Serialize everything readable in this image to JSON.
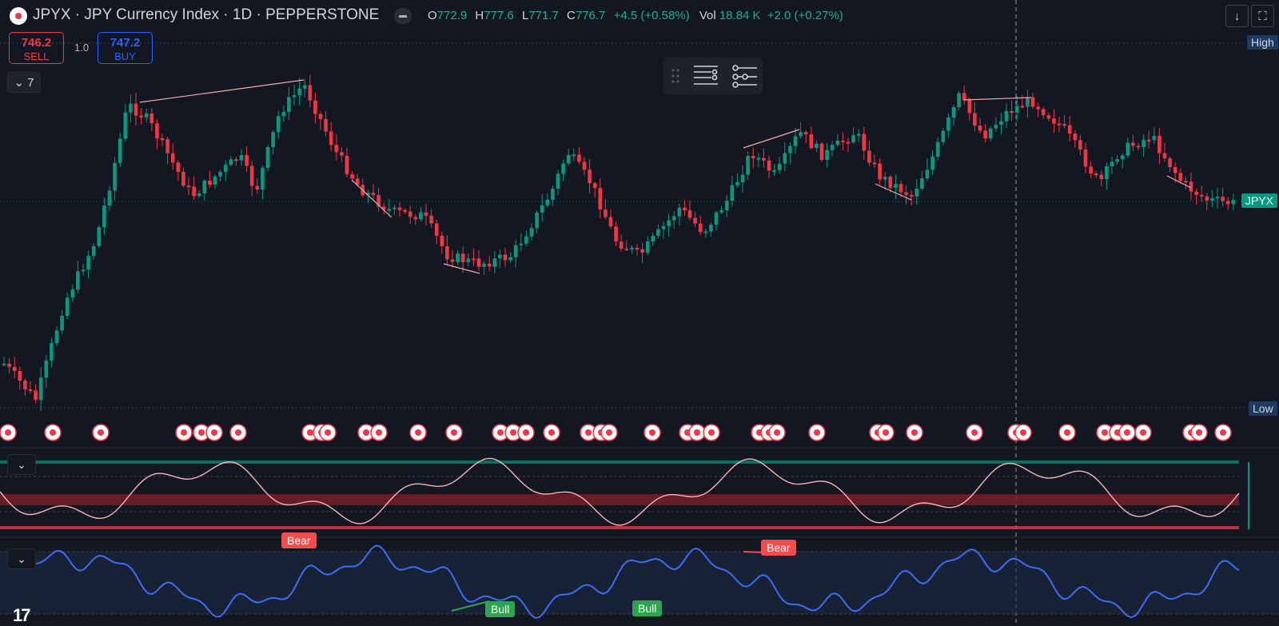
{
  "header": {
    "title": "JPYX · JPY Currency Index · 1D · PEPPERSTONE",
    "ohlc": [
      {
        "k": "O",
        "v": "772.9"
      },
      {
        "k": "H",
        "v": "777.6"
      },
      {
        "k": "L",
        "v": "771.7"
      },
      {
        "k": "C",
        "v": "776.7"
      }
    ],
    "change": "+4.5 (+0.58%)",
    "vol_label": "Vol",
    "vol_value": "18.84 K",
    "vol_change": "+2.0 (+0.27%)"
  },
  "trade": {
    "sell_price": "746.2",
    "sell_label": "SELL",
    "buy_price": "747.2",
    "buy_label": "BUY",
    "quantity": "1.0"
  },
  "indicators_collapse": {
    "count": "7"
  },
  "price_axis": {
    "high_label": "High",
    "low_label": "Low",
    "symbol_label": "JPYX"
  },
  "oscillator_labels": {
    "bear_top": "Bear",
    "bear_mid": "Bear",
    "bull_1": "Bull",
    "bull_2": "Bull"
  },
  "colors": {
    "up": "#089981",
    "down": "#f23645",
    "background": "#131722",
    "oscillator_line": "#3d6cf5"
  },
  "icons": [
    "record-icon",
    "minus-icon",
    "download-icon",
    "fullscreen-icon",
    "chevron-down-icon",
    "drag-handle-icon",
    "object-tree-icon",
    "settings-icon",
    "tradingview-logo-icon"
  ]
}
